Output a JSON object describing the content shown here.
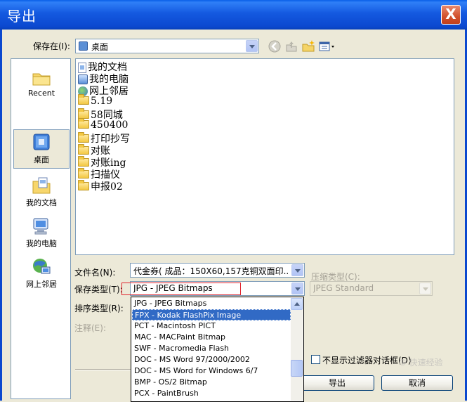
{
  "window": {
    "title": "导出",
    "close_label": "X"
  },
  "save_in": {
    "label": "保存在(I):",
    "value": "桌面"
  },
  "places": [
    {
      "label": "Recent",
      "icon": "recent-folder-icon"
    },
    {
      "label": "桌面",
      "icon": "desktop-icon",
      "selected": true
    },
    {
      "label": "我的文档",
      "icon": "my-documents-icon"
    },
    {
      "label": "我的电脑",
      "icon": "my-computer-icon"
    },
    {
      "label": "网上邻居",
      "icon": "network-places-icon"
    }
  ],
  "files": [
    {
      "name": "我的文档",
      "icon": "document"
    },
    {
      "name": "我的电脑",
      "icon": "computer"
    },
    {
      "name": "网上邻居",
      "icon": "network"
    },
    {
      "name": "5.19",
      "icon": "folder"
    },
    {
      "name": "58同城",
      "icon": "folder"
    },
    {
      "name": "450400",
      "icon": "folder"
    },
    {
      "name": "打印抄写",
      "icon": "folder"
    },
    {
      "name": "对账",
      "icon": "folder"
    },
    {
      "name": "对账ing",
      "icon": "folder"
    },
    {
      "name": "扫描仪",
      "icon": "folder"
    },
    {
      "name": "申报02",
      "icon": "folder"
    }
  ],
  "filename": {
    "label": "文件名(N):",
    "value": "代金券( 成品：150X60,157克铜双面印..."
  },
  "filetype": {
    "label": "保存类型(T):",
    "value": "JPG - JPEG Bitmaps"
  },
  "sort_type": {
    "label": "排序类型(R):"
  },
  "notes": {
    "label": "注释(E):"
  },
  "compression": {
    "label": "压缩类型(C):",
    "value": "JPEG Standard"
  },
  "filetype_options": [
    {
      "label": "JPG - JPEG Bitmaps"
    },
    {
      "label": "FPX - Kodak FlashPix Image",
      "selected": true
    },
    {
      "label": "PCT - Macintosh PICT"
    },
    {
      "label": "MAC - MACPaint Bitmap"
    },
    {
      "label": "SWF - Macromedia Flash"
    },
    {
      "label": "DOC - MS Word 97/2000/2002"
    },
    {
      "label": "DOC - MS Word for Windows 6/7"
    },
    {
      "label": "BMP - OS/2 Bitmap"
    },
    {
      "label": "PCX - PaintBrush"
    }
  ],
  "no_filter_dialog": {
    "label": "不显示过滤器对话框(D)"
  },
  "buttons": {
    "export": "导出",
    "cancel": "取消"
  },
  "watermark": "⑤ 快速经验",
  "colors": {
    "title_bar": "#0b48cf",
    "selection": "#316ac5",
    "highlight_box": "#e0222b"
  }
}
